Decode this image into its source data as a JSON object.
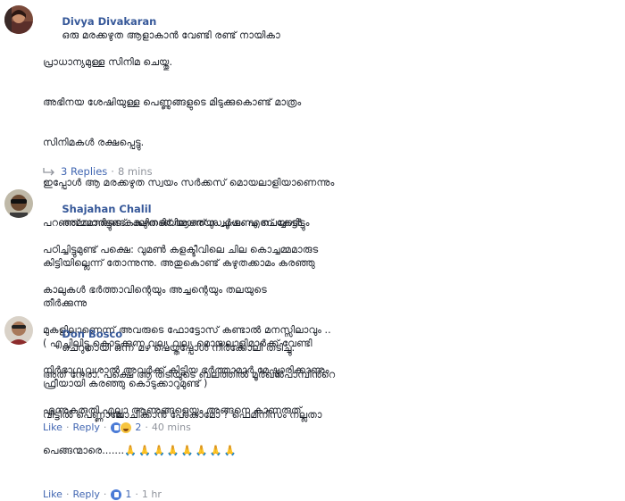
{
  "comments": [
    {
      "author": "Divya Divakaran",
      "lines": [
        "ഒരു മരക്കഴുത ആളാകാൻ വേണ്ടി രണ്ട് നായികാ",
        "പ്രാധാന്യമുള്ള സിനിമ ചെയ്തു.",
        "അഭിനയ ശേഷിയുള്ള പെണ്ണുങ്ങളുടെ മിടുക്കുകൊണ്ട് മാത്രം",
        "സിനിമകൾ രക്ഷപ്പെട്ടു.",
        "ഇപ്പോൾ ആ മരക്കഴുത സ്വയം സർക്കസ് മൊയലാളിയാണെന്നും",
        "പറഞ്ഞ് വന്നിട്ടുണ്ട്. കഴുതക്ക് ആരെയും ചൂഷണം ചെയ്യാൻ",
        "കിട്ടിയില്ലെന്ന് തോന്നുന്നു. അതുകൊണ്ട് കഴുതക്കാമം കരഞ്ഞു",
        "തീർക്കുന്നു",
        "( എച്ചിലിട്ടു കൊടുക്കുന്ന വല്യ വല്യ മൊയലാളിമാർക്ക് വേണ്ടി",
        "ഫ്രീയായി കരഞ്ഞു കൊടുക്കാറുമുണ്ട് )"
      ],
      "like": "Like",
      "reply": "Reply",
      "reactions": "2",
      "time": "40 mins"
    },
    {
      "author": "Shajahan Chalil",
      "lines": [
        "അമ്മമാരുടെ കാലിനടിയിലാണ് സ്വർഗം എന്ന് കേട്ടിട്ടും",
        "പഠിച്ചിട്ടുമുണ്ട് പക്ഷെ: വുമൺ കളക്ടീവിലെ ചില കൊച്ചമ്മമാരുട",
        "കാലുകൾ ഭർത്താവിന്റെയും അച്ചന്റെയും തലയുടെ",
        "മുകളിലാണെന്ന് അവരുടെ ഫോട്ടോസ് കണ്ടാൽ മനസ്സിലാവും ..",
        "നിർഭാഗ്യവശാൽ അവർക്ക് കിട്ടിയ ഭർത്താമാർ മേഷ്മാരിക്കാണും",
        "എന്നുകരുതി എല്ലാ ആണുങ്ങളെയും അങ്ങനെ കാണരുത്",
        "പെങ്ങന്മാരെ......."
      ],
      "like": "Like",
      "reply": "Reply",
      "reactions": "1",
      "time": "1 hr"
    },
    {
      "author": "Don Bosco",
      "lines": [
        "ചെറുതായി ഒന്ന് മഴ പെയ്തപ്പോൾ നീർക്കോലി തടിച്ചു.",
        "അത് നേരാ. പക്ഷെ ആ തടിയുടെ ബലത്തിൽ മൂർഖൻപാമ്പിൻറെ",
        "വീട്ടിൽ പെണ്ണാലോചിക്കാൻ പോകാമോ ? ഫെമിനിസം നല്ലതാ"
      ]
    }
  ],
  "replies_link": {
    "label": "3 Replies",
    "time": "8 mins"
  },
  "hands_emoji": "🙏🙏🙏🙏🙏🙏🙏🙏"
}
